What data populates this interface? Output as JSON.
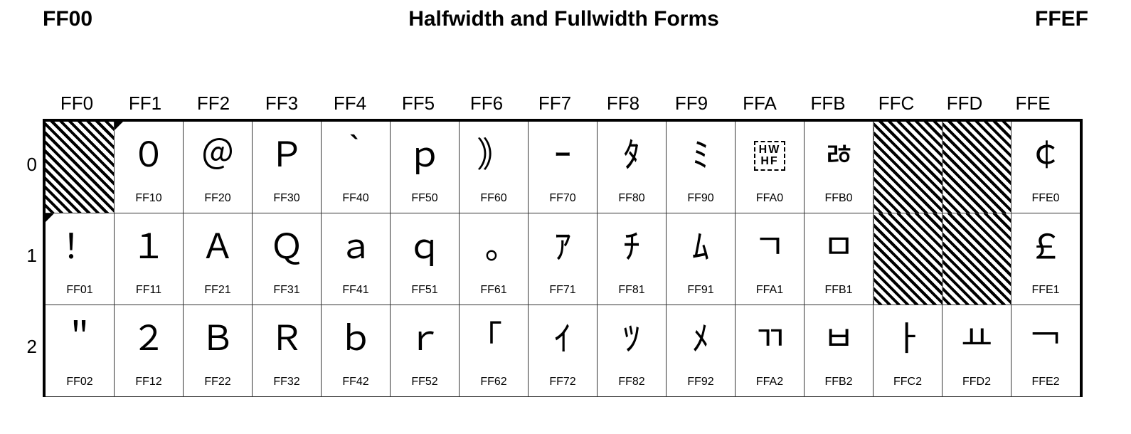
{
  "header": {
    "range_start": "FF00",
    "title": "Halfwidth and Fullwidth Forms",
    "range_end": "FFEF"
  },
  "columns": [
    "FF0",
    "FF1",
    "FF2",
    "FF3",
    "FF4",
    "FF5",
    "FF6",
    "FF7",
    "FF8",
    "FF9",
    "FFA",
    "FFB",
    "FFC",
    "FFD",
    "FFE"
  ],
  "rows": [
    "0",
    "1",
    "2"
  ],
  "cells": [
    [
      {
        "code": "",
        "glyph": "",
        "reserved": true
      },
      {
        "code": "FF10",
        "glyph": "０"
      },
      {
        "code": "FF20",
        "glyph": "＠"
      },
      {
        "code": "FF30",
        "glyph": "Ｐ"
      },
      {
        "code": "FF40",
        "glyph": "｀"
      },
      {
        "code": "FF50",
        "glyph": "ｐ"
      },
      {
        "code": "FF60",
        "glyph": "｠"
      },
      {
        "code": "FF70",
        "glyph": "ｰ"
      },
      {
        "code": "FF80",
        "glyph": "ﾀ"
      },
      {
        "code": "FF90",
        "glyph": "ﾐ"
      },
      {
        "code": "FFA0",
        "glyph": "HWHF",
        "special": "hwhf"
      },
      {
        "code": "FFB0",
        "glyph": "ﾰ"
      },
      {
        "code": "",
        "glyph": "",
        "reserved": true
      },
      {
        "code": "",
        "glyph": "",
        "reserved": true
      },
      {
        "code": "FFE0",
        "glyph": "￠"
      }
    ],
    [
      {
        "code": "FF01",
        "glyph": "！"
      },
      {
        "code": "FF11",
        "glyph": "１"
      },
      {
        "code": "FF21",
        "glyph": "Ａ"
      },
      {
        "code": "FF31",
        "glyph": "Ｑ"
      },
      {
        "code": "FF41",
        "glyph": "ａ"
      },
      {
        "code": "FF51",
        "glyph": "ｑ"
      },
      {
        "code": "FF61",
        "glyph": "｡"
      },
      {
        "code": "FF71",
        "glyph": "ｱ"
      },
      {
        "code": "FF81",
        "glyph": "ﾁ"
      },
      {
        "code": "FF91",
        "glyph": "ﾑ"
      },
      {
        "code": "FFA1",
        "glyph": "ﾡ"
      },
      {
        "code": "FFB1",
        "glyph": "ﾱ"
      },
      {
        "code": "",
        "glyph": "",
        "reserved": true
      },
      {
        "code": "",
        "glyph": "",
        "reserved": true
      },
      {
        "code": "FFE1",
        "glyph": "￡"
      }
    ],
    [
      {
        "code": "FF02",
        "glyph": "＂"
      },
      {
        "code": "FF12",
        "glyph": "２"
      },
      {
        "code": "FF22",
        "glyph": "Ｂ"
      },
      {
        "code": "FF32",
        "glyph": "Ｒ"
      },
      {
        "code": "FF42",
        "glyph": "ｂ"
      },
      {
        "code": "FF52",
        "glyph": "ｒ"
      },
      {
        "code": "FF62",
        "glyph": "｢"
      },
      {
        "code": "FF72",
        "glyph": "ｲ"
      },
      {
        "code": "FF82",
        "glyph": "ﾂ"
      },
      {
        "code": "FF92",
        "glyph": "ﾒ"
      },
      {
        "code": "FFA2",
        "glyph": "ﾢ"
      },
      {
        "code": "FFB2",
        "glyph": "ﾲ"
      },
      {
        "code": "FFC2",
        "glyph": "ￂ"
      },
      {
        "code": "FFD2",
        "glyph": "ￒ"
      },
      {
        "code": "FFE2",
        "glyph": "￢"
      }
    ]
  ],
  "chart_data": {
    "type": "table",
    "title": "Halfwidth and Fullwidth Forms",
    "range": "FF00–FFEF",
    "description": "Unicode code chart grid. Columns are high-nibble groups FF0..FFE, rows are low nibble 0..2 (visible portion). Each cell shows the glyph and its hexadecimal code point. Diagonally hatched cells are reserved/unassigned.",
    "columns_header": [
      "FF0",
      "FF1",
      "FF2",
      "FF3",
      "FF4",
      "FF5",
      "FF6",
      "FF7",
      "FF8",
      "FF9",
      "FFA",
      "FFB",
      "FFC",
      "FFD",
      "FFE"
    ],
    "rows_header": [
      "0",
      "1",
      "2"
    ],
    "reserved_cells": [
      "FF00",
      "FFC0",
      "FFD0",
      "FFC1",
      "FFD1"
    ]
  }
}
